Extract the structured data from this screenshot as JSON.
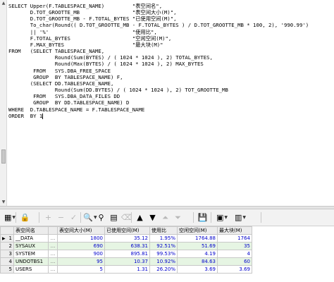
{
  "editor": {
    "lines": [
      "SELECT Upper(F.TABLESPACE_NAME)         \"表空间名\",",
      "       D.TOT_GROOTTE_MB                 \"表空间大小(M)\",",
      "       D.TOT_GROOTTE_MB - F.TOTAL_BYTES \"已使用空间(M)\",",
      "       To_char(Round(( D.TOT_GROOTTE_MB - F.TOTAL_BYTES ) / D.TOT_GROOTTE_MB * 100, 2), '990.99')",
      "       || '%'                           \"使用比\",",
      "       F.TOTAL_BYTES                    \"空闲空间(M)\",",
      "       F.MAX_BYTES                      \"最大块(M)\"",
      "FROM   (SELECT TABLESPACE_NAME,",
      "               Round(Sum(BYTES) / ( 1024 * 1024 ), 2) TOTAL_BYTES,",
      "               Round(Max(BYTES) / ( 1024 * 1024 ), 2) MAX_BYTES",
      "        FROM   SYS.DBA_FREE_SPACE",
      "        GROUP  BY TABLESPACE_NAME) F,",
      "       (SELECT DD.TABLESPACE_NAME,",
      "               Round(Sum(DD.BYTES) / ( 1024 * 1024 ), 2) TOT_GROOTTE_MB",
      "        FROM   SYS.DBA_DATA_FILES DD",
      "        GROUP  BY DD.TABLESPACE_NAME) D",
      "WHERE  D.TABLESPACE_NAME = F.TABLESPACE_NAME",
      "ORDER  BY 1"
    ]
  },
  "toolbar": {
    "buttons": [
      {
        "name": "grid-view-icon",
        "glyph": "▦",
        "dropdown": true,
        "enabled": true
      },
      {
        "name": "lock-icon",
        "glyph": "🔒",
        "dropdown": false,
        "enabled": true
      },
      {
        "name": "add-row-icon",
        "glyph": "+",
        "dropdown": false,
        "enabled": false
      },
      {
        "name": "delete-row-icon",
        "glyph": "−",
        "dropdown": false,
        "enabled": false
      },
      {
        "name": "post-icon",
        "glyph": "✓",
        "dropdown": false,
        "enabled": false
      },
      {
        "name": "find-icon",
        "glyph": "🔍",
        "dropdown": true,
        "enabled": true
      },
      {
        "name": "query-by-example-icon",
        "glyph": "⚲",
        "dropdown": false,
        "enabled": true
      },
      {
        "name": "single-record-view-icon",
        "glyph": "▤",
        "dropdown": false,
        "enabled": true
      },
      {
        "name": "clear-icon",
        "glyph": "⌫",
        "dropdown": false,
        "enabled": false
      },
      {
        "name": "first-record-icon",
        "glyph": "▲",
        "dropdown": false,
        "enabled": true
      },
      {
        "name": "last-record-icon",
        "glyph": "▼",
        "dropdown": false,
        "enabled": true
      },
      {
        "name": "fetch-first-icon",
        "glyph": "⏶",
        "dropdown": false,
        "enabled": false
      },
      {
        "name": "fetch-last-icon",
        "glyph": "⏷",
        "dropdown": false,
        "enabled": false
      },
      {
        "name": "save-icon",
        "glyph": "💾",
        "dropdown": false,
        "enabled": true
      },
      {
        "name": "print-icon",
        "glyph": "▣",
        "dropdown": true,
        "enabled": true
      },
      {
        "name": "chart-icon",
        "glyph": "▥",
        "dropdown": true,
        "enabled": true
      }
    ]
  },
  "grid": {
    "headers": [
      "表空间名",
      "表空间大小(M)",
      "已使用空间(M)",
      "使用比",
      "空闲空间(M)",
      "最大块(M)"
    ],
    "dots_label": "...",
    "rows": [
      {
        "num": "1",
        "name": "__DATA",
        "total": "1800",
        "used": "35.12",
        "pct": "1.95%",
        "free": "1764.88",
        "max": "1764"
      },
      {
        "num": "2",
        "name": "SYSAUX",
        "total": "690",
        "used": "638.31",
        "pct": "92.51%",
        "free": "51.69",
        "max": "35"
      },
      {
        "num": "3",
        "name": "SYSTEM",
        "total": "900",
        "used": "895.81",
        "pct": "99.53%",
        "free": "4.19",
        "max": "4"
      },
      {
        "num": "4",
        "name": "UNDOTBS1",
        "total": "95",
        "used": "10.37",
        "pct": "10.92%",
        "free": "84.63",
        "max": "60"
      },
      {
        "num": "5",
        "name": "USERS",
        "total": "5",
        "used": "1.31",
        "pct": "26.20%",
        "free": "3.69",
        "max": "3.69"
      }
    ]
  }
}
